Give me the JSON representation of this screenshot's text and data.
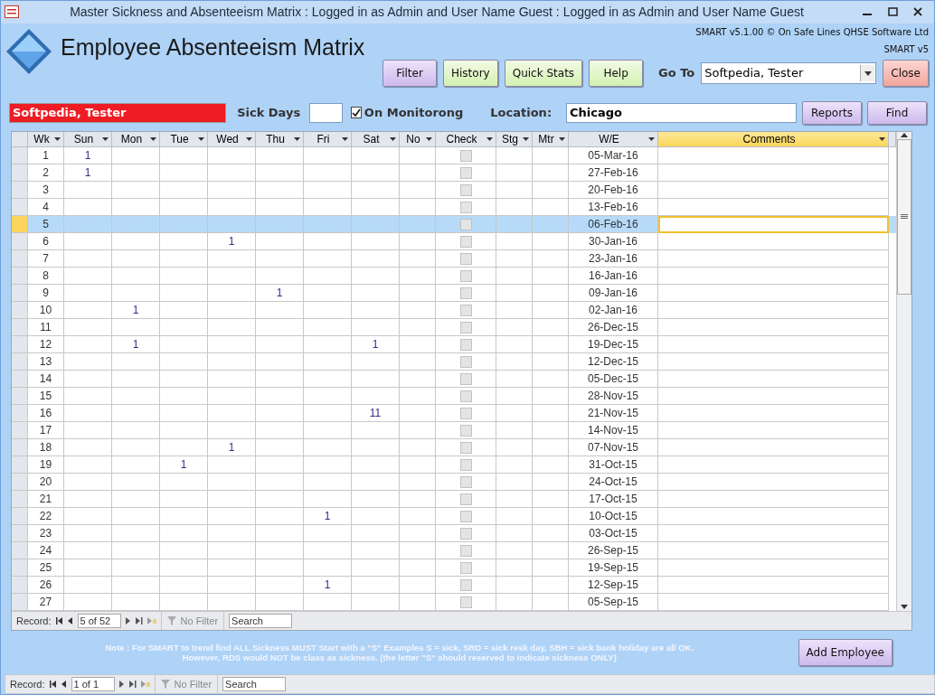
{
  "window": {
    "title": "Master Sickness and Absenteeism Matrix : Logged in as Admin and User Name Guest : Logged in as Admin and User Name Guest"
  },
  "header": {
    "title": "Employee Absenteeism Matrix",
    "copyright": "SMART v5.1.00 © On Safe Lines QHSE Software Ltd",
    "version": "SMART v5"
  },
  "toolbar": {
    "buttons": [
      {
        "label": "Filter",
        "kind": "purple"
      },
      {
        "label": "History",
        "kind": "green"
      },
      {
        "label": "Quick Stats",
        "kind": "green"
      },
      {
        "label": "Help",
        "kind": "green"
      }
    ],
    "goto_label": "Go To",
    "goto_value": "Softpedia, Tester",
    "close": "Close"
  },
  "filter": {
    "employee": "Softpedia, Tester",
    "sick_days_label": "Sick Days",
    "monitoring": {
      "label": "On Monitorong",
      "checked": true
    },
    "location_label": "Location:",
    "location": "Chicago",
    "reports": "Reports",
    "find": "Find"
  },
  "table": {
    "columns": [
      {
        "label": "Wk",
        "selected": false
      },
      {
        "label": "Sun",
        "selected": false
      },
      {
        "label": "Mon",
        "selected": false
      },
      {
        "label": "Tue",
        "selected": false
      },
      {
        "label": "Wed",
        "selected": false
      },
      {
        "label": "Thu",
        "selected": false
      },
      {
        "label": "Fri",
        "selected": false
      },
      {
        "label": "Sat",
        "selected": false
      },
      {
        "label": "No",
        "selected": false
      },
      {
        "label": "Check",
        "selected": false
      },
      {
        "label": "Stg",
        "selected": false
      },
      {
        "label": "Mtr",
        "selected": false
      },
      {
        "label": "W/E",
        "selected": false
      },
      {
        "label": "Comments",
        "selected": true
      }
    ],
    "rows": [
      {
        "wk": "1",
        "days": {
          "sun": "1"
        },
        "checked": false,
        "we": "05-Mar-16",
        "selected": false
      },
      {
        "wk": "2",
        "days": {
          "sun": "1"
        },
        "checked": false,
        "we": "27-Feb-16",
        "selected": false
      },
      {
        "wk": "3",
        "days": {},
        "checked": false,
        "we": "20-Feb-16",
        "selected": false
      },
      {
        "wk": "4",
        "days": {},
        "checked": false,
        "we": "13-Feb-16",
        "selected": false
      },
      {
        "wk": "5",
        "days": {},
        "checked": false,
        "we": "06-Feb-16",
        "selected": true
      },
      {
        "wk": "6",
        "days": {
          "wed": "1"
        },
        "checked": false,
        "we": "30-Jan-16",
        "selected": false
      },
      {
        "wk": "7",
        "days": {},
        "checked": false,
        "we": "23-Jan-16",
        "selected": false
      },
      {
        "wk": "8",
        "days": {},
        "checked": false,
        "we": "16-Jan-16",
        "selected": false
      },
      {
        "wk": "9",
        "days": {
          "thu": "1"
        },
        "checked": false,
        "we": "09-Jan-16",
        "selected": false
      },
      {
        "wk": "10",
        "days": {
          "mon": "1"
        },
        "checked": false,
        "we": "02-Jan-16",
        "selected": false
      },
      {
        "wk": "11",
        "days": {},
        "checked": false,
        "we": "26-Dec-15",
        "selected": false
      },
      {
        "wk": "12",
        "days": {
          "mon": "1",
          "sat": "1"
        },
        "checked": false,
        "we": "19-Dec-15",
        "selected": false
      },
      {
        "wk": "13",
        "days": {},
        "checked": false,
        "we": "12-Dec-15",
        "selected": false
      },
      {
        "wk": "14",
        "days": {},
        "checked": false,
        "we": "05-Dec-15",
        "selected": false
      },
      {
        "wk": "15",
        "days": {},
        "checked": false,
        "we": "28-Nov-15",
        "selected": false
      },
      {
        "wk": "16",
        "days": {
          "sat": "11"
        },
        "checked": false,
        "we": "21-Nov-15",
        "selected": false
      },
      {
        "wk": "17",
        "days": {},
        "checked": false,
        "we": "14-Nov-15",
        "selected": false
      },
      {
        "wk": "18",
        "days": {
          "wed": "1"
        },
        "checked": false,
        "we": "07-Nov-15",
        "selected": false
      },
      {
        "wk": "19",
        "days": {
          "tue": "1"
        },
        "checked": false,
        "we": "31-Oct-15",
        "selected": false
      },
      {
        "wk": "20",
        "days": {},
        "checked": false,
        "we": "24-Oct-15",
        "selected": false
      },
      {
        "wk": "21",
        "days": {},
        "checked": false,
        "we": "17-Oct-15",
        "selected": false
      },
      {
        "wk": "22",
        "days": {
          "fri": "1"
        },
        "checked": false,
        "we": "10-Oct-15",
        "selected": false
      },
      {
        "wk": "23",
        "days": {},
        "checked": false,
        "we": "03-Oct-15",
        "selected": false
      },
      {
        "wk": "24",
        "days": {},
        "checked": false,
        "we": "26-Sep-15",
        "selected": false
      },
      {
        "wk": "25",
        "days": {},
        "checked": false,
        "we": "19-Sep-15",
        "selected": false
      },
      {
        "wk": "26",
        "days": {
          "fri": "1"
        },
        "checked": false,
        "we": "12-Sep-15",
        "selected": false
      },
      {
        "wk": "27",
        "days": {},
        "checked": false,
        "we": "05-Sep-15",
        "selected": false
      }
    ],
    "navigator": {
      "label": "Record:",
      "position": "5 of 52",
      "filter": "No Filter",
      "search": "Search"
    }
  },
  "note": {
    "lines": [
      "Note : For SMART to trend find ALL Sickness MUST Start with a \"S\" Examples S = sick, SRD = sick resk day, SBH = sick bank holiday are all  OK.",
      "However, RDS would NOT be class as sickness.   (the letter \"S\" should reserved to indicate sickness ONLY)"
    ],
    "add_button": "Add Employee"
  },
  "form_navigator": {
    "label": "Record:",
    "position": "1 of 1",
    "filter": "No Filter",
    "search": "Search"
  }
}
